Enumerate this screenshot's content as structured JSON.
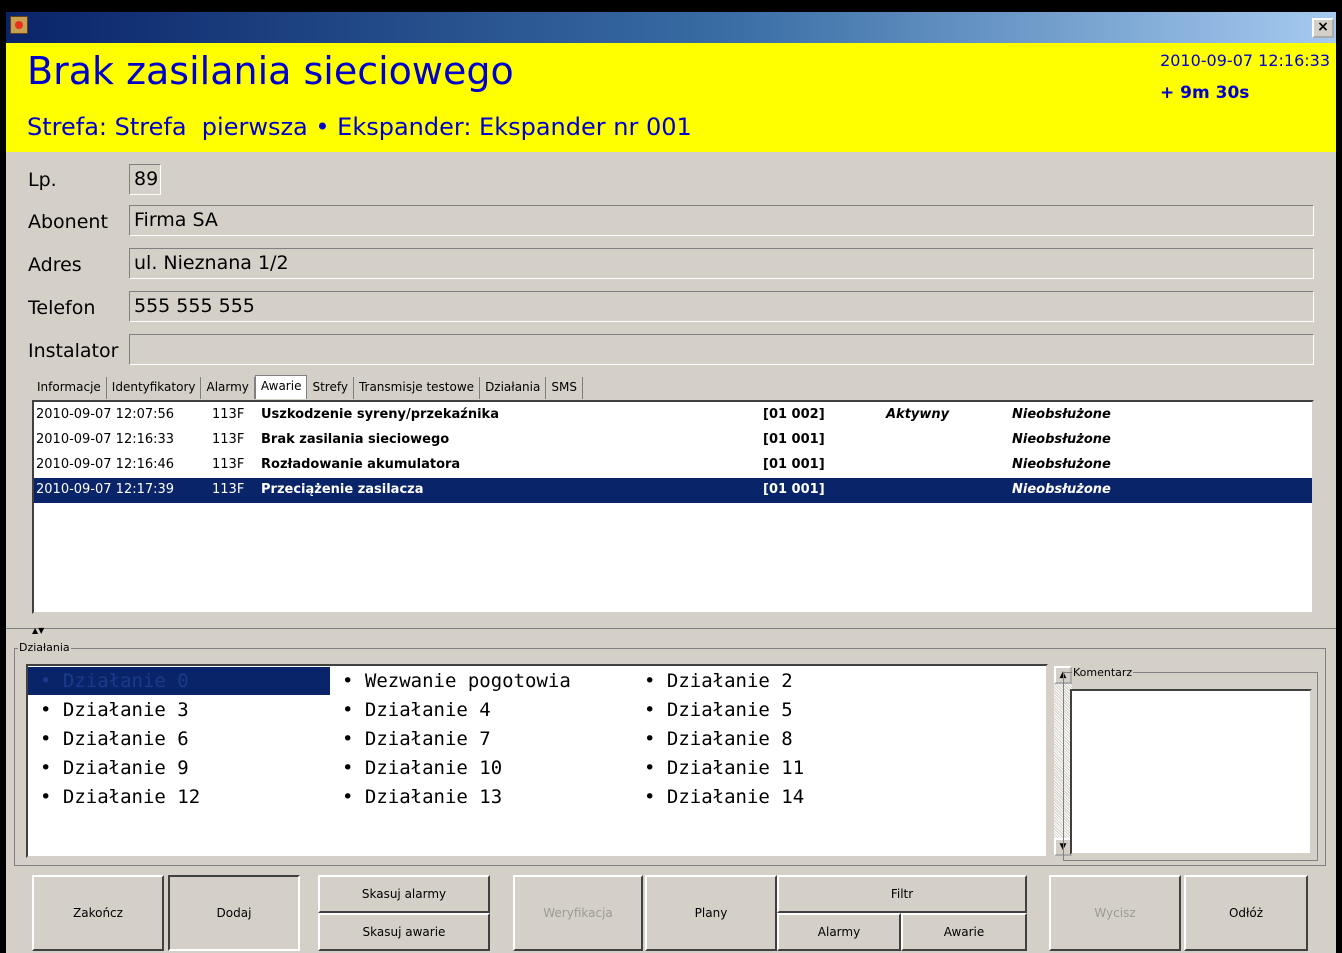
{
  "window": {
    "close_glyph": "×"
  },
  "header": {
    "title": "Brak zasilania sieciowego",
    "subtitle": "Strefa: Strefa  pierwsza • Ekspander: Ekspander nr 001",
    "datetime": "2010-09-07 12:16:33",
    "elapsed": "+ 9m 30s",
    "background": "#ffff00",
    "text_color": "#0000cc"
  },
  "fields": {
    "lp_label": "Lp.",
    "lp_value": "89",
    "abonent_label": "Abonent",
    "abonent_value": "Firma SA",
    "adres_label": "Adres",
    "adres_value": "ul. Nieznana 1/2",
    "telefon_label": "Telefon",
    "telefon_value": "555 555 555",
    "instalator_label": "Instalator",
    "instalator_value": ""
  },
  "tabs": [
    {
      "label": "Informacje"
    },
    {
      "label": "Identyfikatory"
    },
    {
      "label": "Alarmy"
    },
    {
      "label": "Awarie",
      "active": true
    },
    {
      "label": "Strefy"
    },
    {
      "label": "Transmisje testowe"
    },
    {
      "label": "Działania"
    },
    {
      "label": "SMS"
    }
  ],
  "events": [
    {
      "time": "2010-09-07 12:07:56",
      "code": "113F",
      "desc": "Uszkodzenie syreny/przekaźnika",
      "zone": "[01 002]",
      "state": "Aktywny",
      "status": "Nieobsłużone"
    },
    {
      "time": "2010-09-07 12:16:33",
      "code": "113F",
      "desc": "Brak zasilania sieciowego",
      "zone": "[01 001]",
      "state": "",
      "status": "Nieobsłużone"
    },
    {
      "time": "2010-09-07 12:16:46",
      "code": "113F",
      "desc": "Rozładowanie akumulatora",
      "zone": "[01 001]",
      "state": "",
      "status": "Nieobsłużone"
    },
    {
      "time": "2010-09-07 12:17:39",
      "code": "113F",
      "desc": "Przeciążenie zasilacza",
      "zone": "[01 001]",
      "state": "",
      "status": "Nieobsłużone",
      "selected": true
    }
  ],
  "actions_group_title": "Działania",
  "actions": [
    [
      "• Działanie 0",
      "• Wezwanie pogotowia",
      "• Działanie 2"
    ],
    [
      "• Działanie 3",
      "• Działanie 4",
      "• Działanie 5"
    ],
    [
      "• Działanie 6",
      "• Działanie 7",
      "• Działanie 8"
    ],
    [
      "• Działanie 9",
      "• Działanie 10",
      "• Działanie 11"
    ],
    [
      "• Działanie 12",
      "• Działanie 13",
      "• Działanie 14"
    ]
  ],
  "comment_title": "Komentarz",
  "scroll_up_glyph": "▲",
  "scroll_down_glyph": "▼",
  "splitter_glyph": "▲▼",
  "buttons": {
    "zakoncz": "Zakończ",
    "dodaj": "Dodaj",
    "skasuj_alarmy": "Skasuj alarmy",
    "skasuj_awarie": "Skasuj awarie",
    "weryfikacja": "Weryfikacja",
    "plany": "Plany",
    "filtr": "Filtr",
    "filtr_alarmy": "Alarmy",
    "filtr_awarie": "Awarie",
    "wycisz": "Wycisz",
    "odloz": "Odłóż"
  }
}
